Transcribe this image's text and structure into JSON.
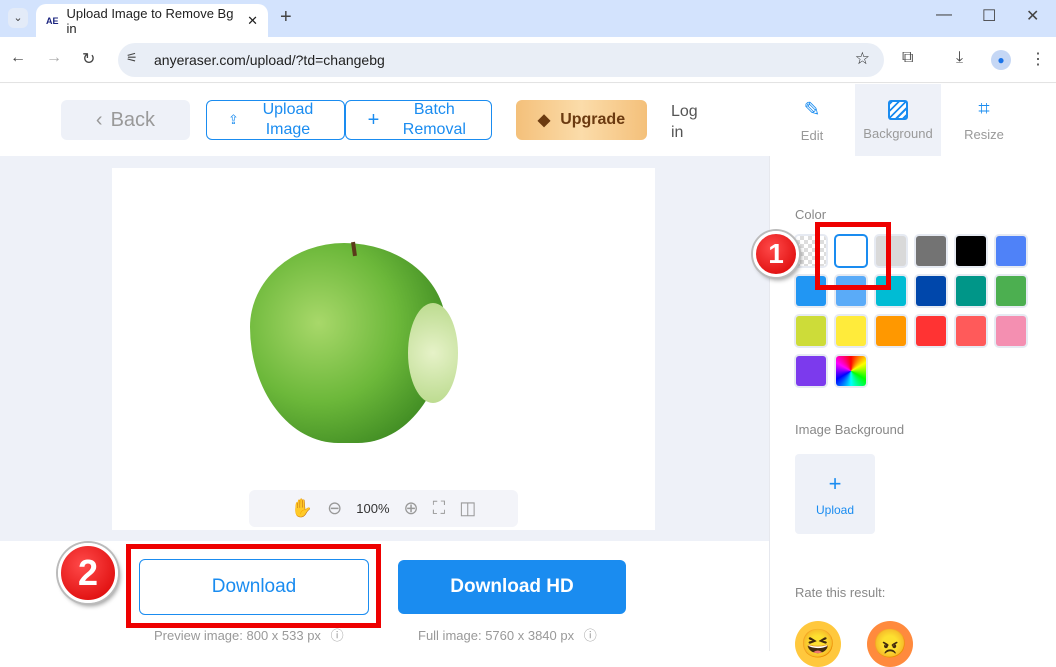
{
  "browser": {
    "tab_title": "Upload Image to Remove Bg in",
    "tab_favicon": "AE",
    "url": "anyeraser.com/upload/?td=changebg"
  },
  "header": {
    "back": "Back",
    "upload": "Upload Image",
    "batch": "Batch Removal",
    "upgrade": "Upgrade",
    "login": "Log in",
    "tools": [
      {
        "label": "Edit",
        "icon": "edit-icon"
      },
      {
        "label": "Background",
        "icon": "background-icon",
        "active": true
      },
      {
        "label": "Resize",
        "icon": "crop-icon"
      }
    ]
  },
  "viewer": {
    "zoom": "100%"
  },
  "download": {
    "download": "Download",
    "download_hd": "Download HD",
    "preview_info": "Preview image: 800 x 533 px",
    "full_info": "Full image: 5760 x 3840 px"
  },
  "panel": {
    "color_label": "Color",
    "colors": [
      "transparent",
      "#ffffff",
      "#d9d9d9",
      "#737373",
      "#000000",
      "#4f82f8",
      "#2196f3",
      "#5aabf8",
      "#00bcd4",
      "#0047ab",
      "#009688",
      "#4caf50",
      "#cddc39",
      "#ffeb3b",
      "#ff9800",
      "#ff3333",
      "#ff5a5a",
      "#f48fb1",
      "#7c3aed",
      "rainbow"
    ],
    "selected_color": "#ffffff",
    "image_bg_label": "Image Background",
    "upload": "Upload",
    "rate": "Rate this result:"
  },
  "annotations": [
    "1",
    "2"
  ]
}
